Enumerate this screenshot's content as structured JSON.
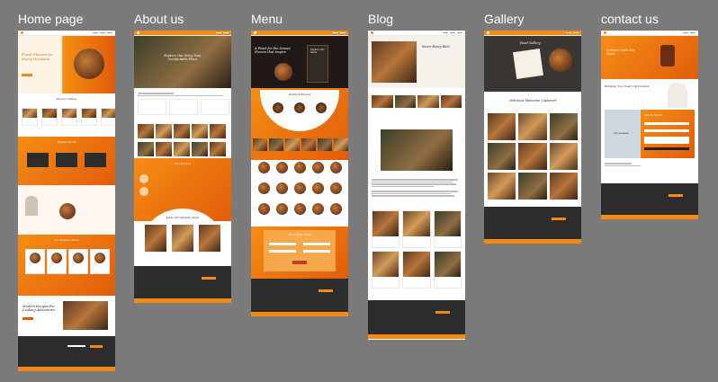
{
  "frames": [
    {
      "id": "home",
      "label": "Home page"
    },
    {
      "id": "about",
      "label": "About us"
    },
    {
      "id": "menu",
      "label": "Menu"
    },
    {
      "id": "blog",
      "label": "Blog"
    },
    {
      "id": "gallery",
      "label": "Gallery"
    },
    {
      "id": "contact",
      "label": "contact us"
    }
  ],
  "home": {
    "hero_title": "Fresh Flavors for Every Occasion",
    "popular_title": "Popular Dishes",
    "special_title": "Special Deals",
    "services_title": "Our Popular Menu",
    "blog_title": "Modern Recipes For Cooking Adventures"
  },
  "about": {
    "hero_title": "Explore Our Story Your Comfortable Place",
    "our_kitchen": "Our Kitchen",
    "team_title": "Meet Our Kitchen Team"
  },
  "menu": {
    "hero_title": "A Feast for the Senses Flavors that Inspire",
    "card_title": "Explore Our Menu",
    "special_title": "Curated Flavors",
    "book_title": "Book Your Table"
  },
  "blog": {
    "hero_title": "Savor Every Bite!"
  },
  "gallery": {
    "hero_title": "Food Gallery",
    "section_title": "Delicious Moments Captured"
  },
  "contact": {
    "hero_title": "Connect with Our Team",
    "section_title": "Bringing You Closer Information",
    "form_title": "Get In Touch",
    "map_label": "Our Location"
  },
  "colors": {
    "accent": "#f28a13",
    "accent_dark": "#e25c0a",
    "canvas": "#7b7b7b",
    "footer": "#2c2c2c"
  }
}
